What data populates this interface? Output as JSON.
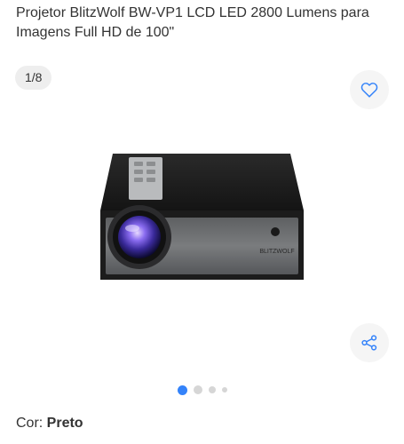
{
  "product": {
    "title": "Projetor BlitzWolf BW-VP1 LCD LED 2800 Lumens para Imagens Full HD de 100\"",
    "image_brand_label": "BLITZWOLF"
  },
  "gallery": {
    "counter": "1/8",
    "dots_count": 4,
    "active_dot": 0
  },
  "actions": {
    "favorite_icon": "heart-icon",
    "share_icon": "share-icon"
  },
  "variant": {
    "label": "Cor: ",
    "value": "Preto"
  },
  "colors": {
    "accent": "#3483fa",
    "text": "#333333",
    "dot_inactive": "#d6d6d6"
  }
}
